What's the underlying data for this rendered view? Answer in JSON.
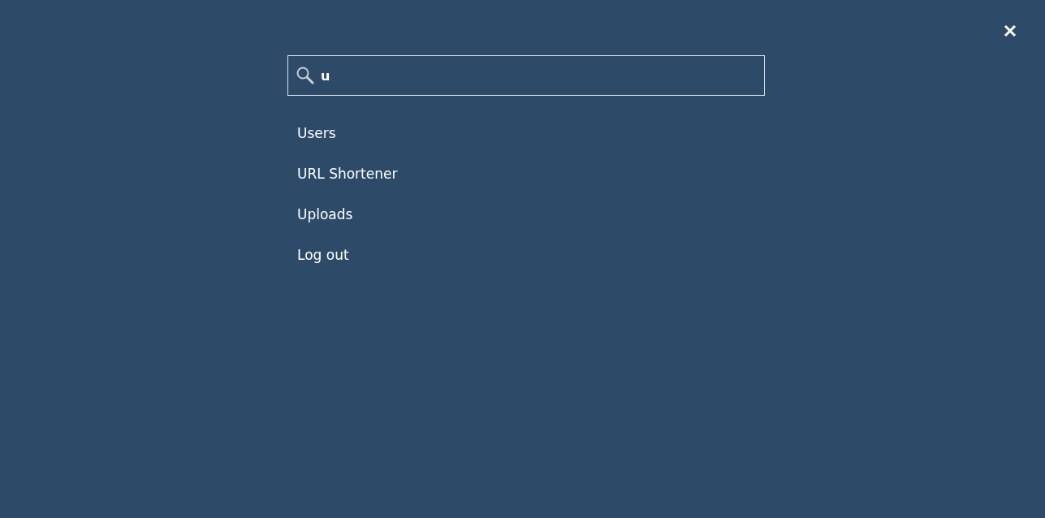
{
  "search": {
    "value": "u"
  },
  "results": [
    {
      "label": "Users"
    },
    {
      "label": "URL Shortener"
    },
    {
      "label": "Uploads"
    },
    {
      "label": "Log out"
    }
  ]
}
